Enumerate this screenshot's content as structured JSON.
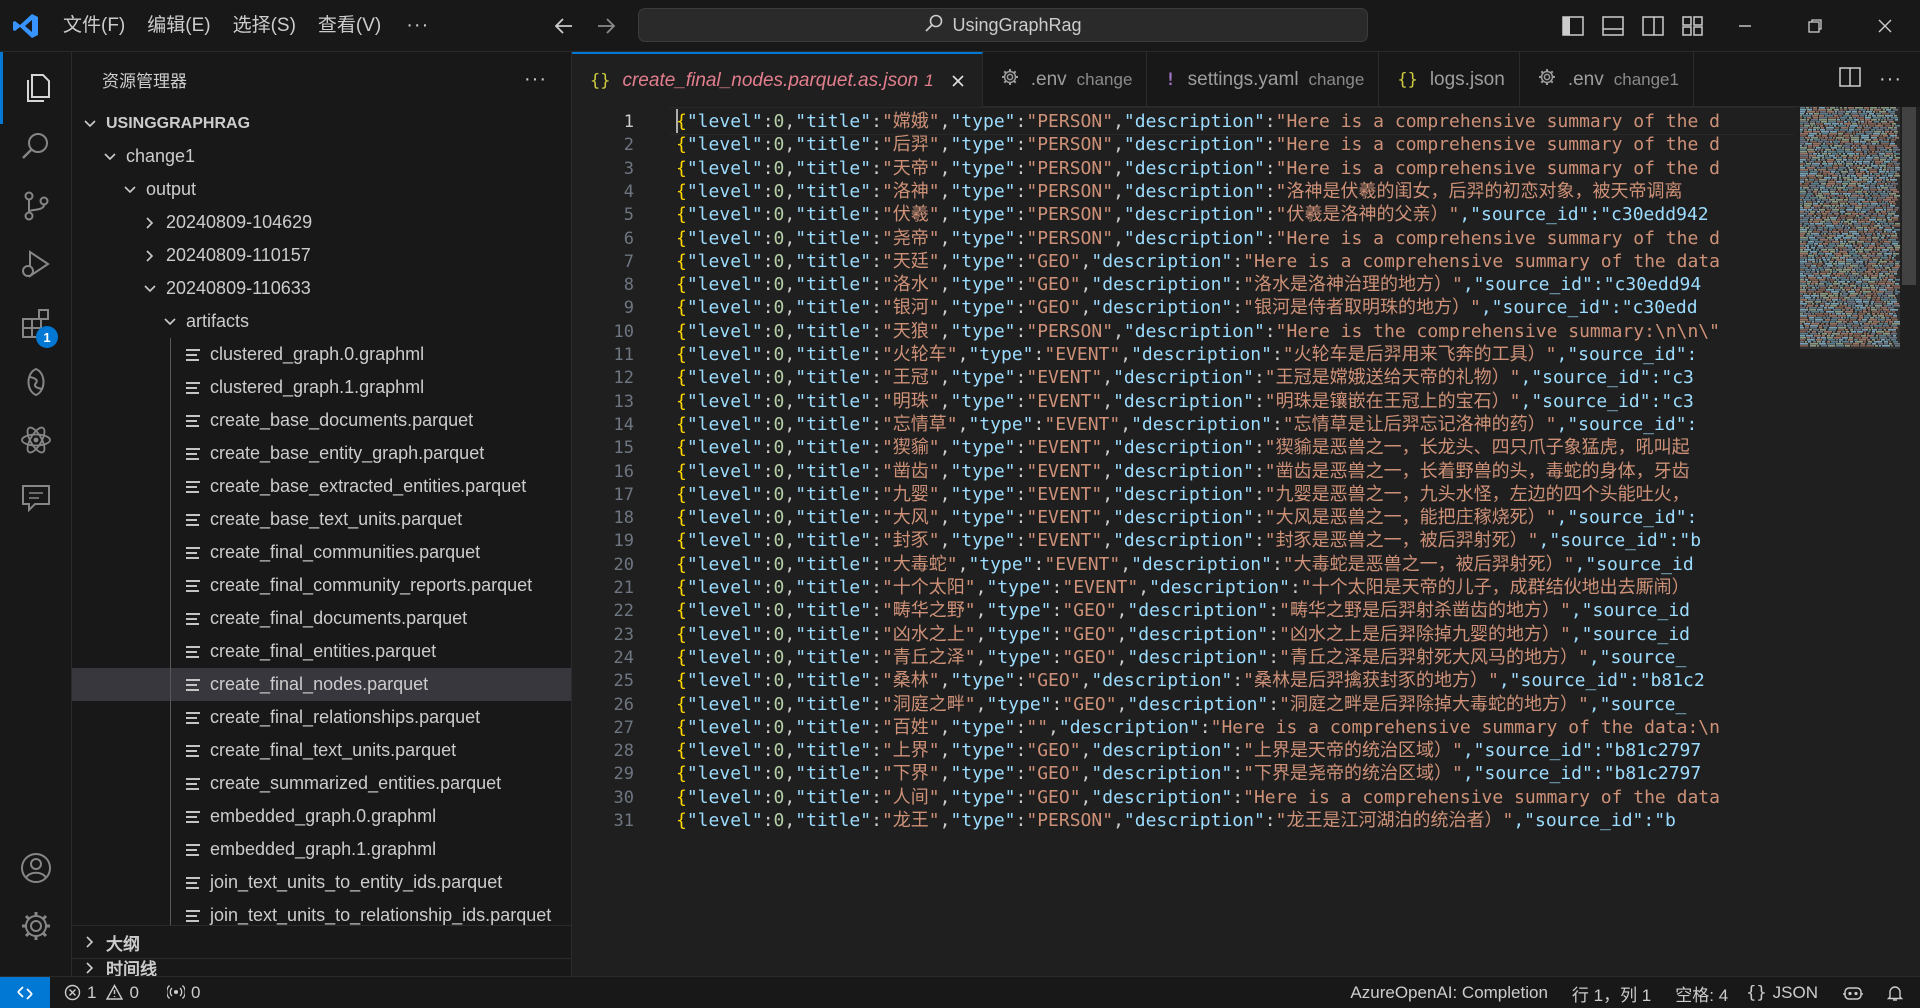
{
  "titlebar": {
    "menus": [
      "文件(F)",
      "编辑(E)",
      "选择(S)",
      "查看(V)"
    ],
    "more": "···",
    "search_text": "UsingGraphRag"
  },
  "activity_badge": "1",
  "sidebar": {
    "title": "资源管理器",
    "more": "···",
    "root": "USINGGRAPHRAG",
    "tree": [
      {
        "label": "change1",
        "depth": 1,
        "kind": "folder-open"
      },
      {
        "label": "output",
        "depth": 2,
        "kind": "folder-open"
      },
      {
        "label": "20240809-104629",
        "depth": 3,
        "kind": "folder-closed"
      },
      {
        "label": "20240809-110157",
        "depth": 3,
        "kind": "folder-closed"
      },
      {
        "label": "20240809-110633",
        "depth": 3,
        "kind": "folder-open"
      },
      {
        "label": "artifacts",
        "depth": 4,
        "kind": "folder-open"
      },
      {
        "label": "clustered_graph.0.graphml",
        "depth": 5,
        "kind": "file"
      },
      {
        "label": "clustered_graph.1.graphml",
        "depth": 5,
        "kind": "file"
      },
      {
        "label": "create_base_documents.parquet",
        "depth": 5,
        "kind": "file"
      },
      {
        "label": "create_base_entity_graph.parquet",
        "depth": 5,
        "kind": "file"
      },
      {
        "label": "create_base_extracted_entities.parquet",
        "depth": 5,
        "kind": "file"
      },
      {
        "label": "create_base_text_units.parquet",
        "depth": 5,
        "kind": "file"
      },
      {
        "label": "create_final_communities.parquet",
        "depth": 5,
        "kind": "file"
      },
      {
        "label": "create_final_community_reports.parquet",
        "depth": 5,
        "kind": "file"
      },
      {
        "label": "create_final_documents.parquet",
        "depth": 5,
        "kind": "file"
      },
      {
        "label": "create_final_entities.parquet",
        "depth": 5,
        "kind": "file"
      },
      {
        "label": "create_final_nodes.parquet",
        "depth": 5,
        "kind": "file",
        "selected": true
      },
      {
        "label": "create_final_relationships.parquet",
        "depth": 5,
        "kind": "file"
      },
      {
        "label": "create_final_text_units.parquet",
        "depth": 5,
        "kind": "file"
      },
      {
        "label": "create_summarized_entities.parquet",
        "depth": 5,
        "kind": "file"
      },
      {
        "label": "embedded_graph.0.graphml",
        "depth": 5,
        "kind": "file"
      },
      {
        "label": "embedded_graph.1.graphml",
        "depth": 5,
        "kind": "file"
      },
      {
        "label": "join_text_units_to_entity_ids.parquet",
        "depth": 5,
        "kind": "file"
      },
      {
        "label": "join_text_units_to_relationship_ids.parquet",
        "depth": 5,
        "kind": "file"
      }
    ],
    "sections": [
      "大纲",
      "时间线"
    ]
  },
  "tabs": [
    {
      "icon": "{}",
      "label": "create_final_nodes.parquet.as.json",
      "desc": "1",
      "active": true,
      "icon_color": "#cbcb41"
    },
    {
      "icon": "gear",
      "label": ".env",
      "desc": "change",
      "active": false,
      "icon_color": "#9d9d9d"
    },
    {
      "icon": "!",
      "label": "settings.yaml",
      "desc": "change",
      "active": false,
      "icon_color": "#a074c4"
    },
    {
      "icon": "{}",
      "label": "logs.json",
      "desc": "",
      "active": false,
      "icon_color": "#cbcb41"
    },
    {
      "icon": "gear",
      "label": ".env",
      "desc": "change1",
      "active": false,
      "icon_color": "#9d9d9d"
    }
  ],
  "editor": {
    "lines": [
      {
        "n": "1",
        "title": "嫦娥",
        "type": "PERSON",
        "desc": "Here is a comprehensive summary of the d"
      },
      {
        "n": "2",
        "title": "后羿",
        "type": "PERSON",
        "desc": "Here is a comprehensive summary of the d"
      },
      {
        "n": "3",
        "title": "天帝",
        "type": "PERSON",
        "desc": "Here is a comprehensive summary of the d"
      },
      {
        "n": "4",
        "title": "洛神",
        "type": "PERSON",
        "desc": "洛神是伏羲的闺女，后羿的初恋对象，被天帝调离"
      },
      {
        "n": "5",
        "title": "伏羲",
        "type": "PERSON",
        "desc": "伏羲是洛神的父亲）",
        "rest": ",\"source_id\":\"c30edd942"
      },
      {
        "n": "6",
        "title": "尧帝",
        "type": "PERSON",
        "desc": "Here is a comprehensive summary of the d"
      },
      {
        "n": "7",
        "title": "天廷",
        "type": "GEO",
        "desc": "Here is a comprehensive summary of the data"
      },
      {
        "n": "8",
        "title": "洛水",
        "type": "GEO",
        "desc": "洛水是洛神治理的地方）",
        "rest": ",\"source_id\":\"c30edd94"
      },
      {
        "n": "9",
        "title": "银河",
        "type": "GEO",
        "desc": "银河是侍者取明珠的地方）",
        "rest": ",\"source_id\":\"c30edd"
      },
      {
        "n": "10",
        "title": "天狼",
        "type": "PERSON",
        "desc": "Here is the comprehensive summary:\\n\\n\\\""
      },
      {
        "n": "11",
        "title": "火轮车",
        "type": "EVENT",
        "desc": "火轮车是后羿用来飞奔的工具）",
        "rest": ",\"source_id\":"
      },
      {
        "n": "12",
        "title": "王冠",
        "type": "EVENT",
        "desc": "王冠是嫦娥送给天帝的礼物）",
        "rest": ",\"source_id\":\"c3"
      },
      {
        "n": "13",
        "title": "明珠",
        "type": "EVENT",
        "desc": "明珠是镶嵌在王冠上的宝石）",
        "rest": ",\"source_id\":\"c3"
      },
      {
        "n": "14",
        "title": "忘情草",
        "type": "EVENT",
        "desc": "忘情草是让后羿忘记洛神的药）",
        "rest": ",\"source_id\":"
      },
      {
        "n": "15",
        "title": "猰貐",
        "type": "EVENT",
        "desc": "猰貐是恶兽之一，长龙头、四只爪子象猛虎，吼叫起"
      },
      {
        "n": "16",
        "title": "凿齿",
        "type": "EVENT",
        "desc": "凿齿是恶兽之一，长着野兽的头，毒蛇的身体，牙齿"
      },
      {
        "n": "17",
        "title": "九婴",
        "type": "EVENT",
        "desc": "九婴是恶兽之一，九头水怪，左边的四个头能吐火，"
      },
      {
        "n": "18",
        "title": "大风",
        "type": "EVENT",
        "desc": "大风是恶兽之一，能把庄稼烧死）",
        "rest": ",\"source_id\":"
      },
      {
        "n": "19",
        "title": "封豕",
        "type": "EVENT",
        "desc": "封豕是恶兽之一，被后羿射死）",
        "rest": ",\"source_id\":\"b"
      },
      {
        "n": "20",
        "title": "大毒蛇",
        "type": "EVENT",
        "desc": "大毒蛇是恶兽之一，被后羿射死）",
        "rest": ",\"source_id"
      },
      {
        "n": "21",
        "title": "十个太阳",
        "type": "EVENT",
        "desc": "十个太阳是天帝的儿子，成群结伙地出去厮闹）"
      },
      {
        "n": "22",
        "title": "畴华之野",
        "type": "GEO",
        "desc": "畴华之野是后羿射杀凿齿的地方）",
        "rest": ",\"source_id"
      },
      {
        "n": "23",
        "title": "凶水之上",
        "type": "GEO",
        "desc": "凶水之上是后羿除掉九婴的地方）",
        "rest": ",\"source_id"
      },
      {
        "n": "24",
        "title": "青丘之泽",
        "type": "GEO",
        "desc": "青丘之泽是后羿射死大风马的地方）",
        "rest": ",\"source_"
      },
      {
        "n": "25",
        "title": "桑林",
        "type": "GEO",
        "desc": "桑林是后羿擒获封豕的地方）",
        "rest": ",\"source_id\":\"b81c2"
      },
      {
        "n": "26",
        "title": "洞庭之畔",
        "type": "GEO",
        "desc": "洞庭之畔是后羿除掉大毒蛇的地方）",
        "rest": ",\"source_"
      },
      {
        "n": "27",
        "title": "百姓",
        "type": "",
        "desc": "Here is a comprehensive summary of the data:\\n"
      },
      {
        "n": "28",
        "title": "上界",
        "type": "GEO",
        "desc": "上界是天帝的统治区域）",
        "rest": ",\"source_id\":\"b81c2797"
      },
      {
        "n": "29",
        "title": "下界",
        "type": "GEO",
        "desc": "下界是尧帝的统治区域）",
        "rest": ",\"source_id\":\"b81c2797"
      },
      {
        "n": "30",
        "title": "人间",
        "type": "GEO",
        "desc": "Here is a comprehensive summary of the data"
      },
      {
        "n": "31",
        "title": "龙王",
        "type": "PERSON",
        "desc": "龙王是江河湖泊的统治者）",
        "rest": ",\"source_id\":\"b"
      }
    ]
  },
  "statusbar": {
    "errors": "1",
    "warnings": "0",
    "ports": "0",
    "model": "AzureOpenAI: Completion",
    "position": "行 1，列 1",
    "spaces": "空格: 4",
    "language": "JSON"
  }
}
